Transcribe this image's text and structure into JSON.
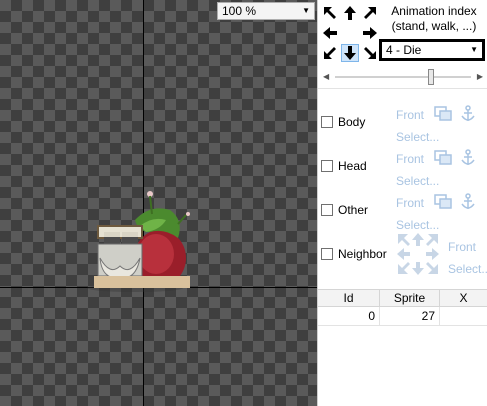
{
  "canvas": {
    "zoom": "100 %"
  },
  "panel": {
    "anim_label": "Animation index\n(stand, walk, ...)",
    "anim_selected": "4 - Die",
    "direction_selected": "down",
    "frame_position": 0.68,
    "layers": [
      {
        "name": "Body",
        "front": "Front",
        "select": "Select..."
      },
      {
        "name": "Head",
        "front": "Front",
        "select": "Select..."
      },
      {
        "name": "Other",
        "front": "Front",
        "select": "Select..."
      },
      {
        "name": "Neighbor",
        "front": "Front",
        "select": "Select..."
      }
    ],
    "table": {
      "headers": [
        "Id",
        "Sprite",
        "X"
      ],
      "rows": [
        [
          "0",
          "27",
          ""
        ]
      ]
    }
  },
  "colors": {
    "accent": "#7fb6ea",
    "disabled_text": "#a9c4e2"
  }
}
